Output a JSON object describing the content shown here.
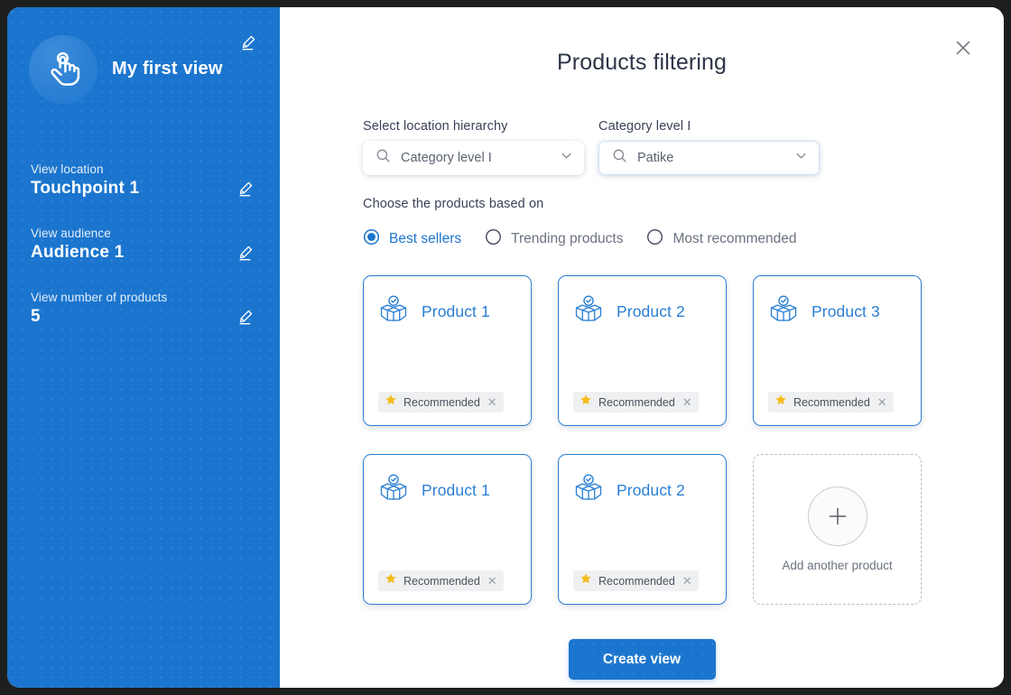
{
  "sidebar": {
    "brand": {
      "icon": "touch-gesture-icon",
      "title": "My first view",
      "edit_icon": "pencil-icon"
    },
    "fields": [
      {
        "label": "View  location",
        "value": "Touchpoint 1",
        "edit_icon": "pencil-icon"
      },
      {
        "label": "View  audience",
        "value": "Audience 1",
        "edit_icon": "pencil-icon"
      },
      {
        "label": "View  number of products",
        "value": "5",
        "edit_icon": "pencil-icon"
      }
    ],
    "bg_color": "#1b75ce"
  },
  "main": {
    "title": "Products filtering",
    "close_icon": "close-icon",
    "selects": [
      {
        "label": "Select location hierarchy",
        "value": "Category level I",
        "search_icon": "search-icon",
        "chevron_icon": "chevron-down-icon",
        "highlighted": false
      },
      {
        "label": "Category level I",
        "value": "Patike",
        "search_icon": "search-icon",
        "chevron_icon": "chevron-down-icon",
        "highlighted": true
      }
    ],
    "radio_group": {
      "label": "Choose the products based on",
      "options": [
        {
          "label": "Best sellers",
          "selected": true
        },
        {
          "label": "Trending products",
          "selected": false
        },
        {
          "label": "Most recommended",
          "selected": false
        }
      ]
    },
    "products": [
      {
        "name": "Product 1",
        "icon": "product-box-icon",
        "tag": {
          "icon": "star-icon",
          "text": "Recommended",
          "remove_icon": "close-icon"
        }
      },
      {
        "name": "Product 2",
        "icon": "product-box-icon",
        "tag": {
          "icon": "star-icon",
          "text": "Recommended",
          "remove_icon": "close-icon"
        }
      },
      {
        "name": "Product 3",
        "icon": "product-box-icon",
        "tag": {
          "icon": "star-icon",
          "text": "Recommended",
          "remove_icon": "close-icon"
        }
      },
      {
        "name": "Product 1",
        "icon": "product-box-icon",
        "tag": {
          "icon": "star-icon",
          "text": "Recommended",
          "remove_icon": "close-icon"
        }
      },
      {
        "name": "Product 2",
        "icon": "product-box-icon",
        "tag": {
          "icon": "star-icon",
          "text": "Recommended",
          "remove_icon": "close-icon"
        }
      }
    ],
    "add_card": {
      "label": "Add another product",
      "icon": "plus-icon"
    },
    "submit_label": "Create view"
  },
  "colors": {
    "brand_blue": "#1b75ce",
    "card_blue": "#2a7fd4",
    "star_yellow": "#f5bc1c",
    "title_text": "#2e3548"
  }
}
